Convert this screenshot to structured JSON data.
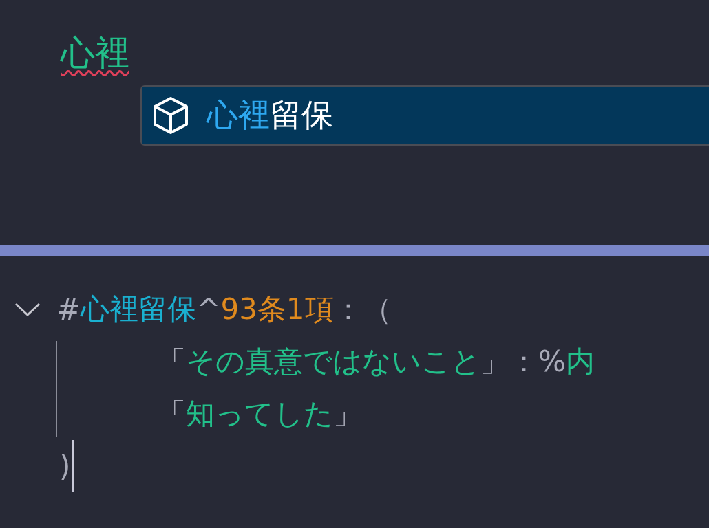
{
  "top_editor": {
    "typed_text": "心裡",
    "has_error": true,
    "suggestions": [
      {
        "kind": "symbol",
        "match": "心裡",
        "rest": "留保",
        "selected": true
      }
    ]
  },
  "bottom_editor": {
    "expanded": true,
    "header": [
      {
        "kind": "punct",
        "text": "#"
      },
      {
        "kind": "name",
        "text": "心裡留保"
      },
      {
        "kind": "punct",
        "text": "^"
      },
      {
        "kind": "ref",
        "text": "93条1項"
      },
      {
        "kind": "punct",
        "text": "：（"
      }
    ],
    "lines": [
      [
        {
          "kind": "punct",
          "text": "「"
        },
        {
          "kind": "string",
          "text": "その真意ではないこと"
        },
        {
          "kind": "punct",
          "text": "」：%"
        },
        {
          "kind": "string",
          "text": "内"
        }
      ],
      [
        {
          "kind": "punct",
          "text": "「"
        },
        {
          "kind": "string",
          "text": "知ってした"
        },
        {
          "kind": "punct",
          "text": "」"
        }
      ]
    ],
    "closing": ")"
  }
}
